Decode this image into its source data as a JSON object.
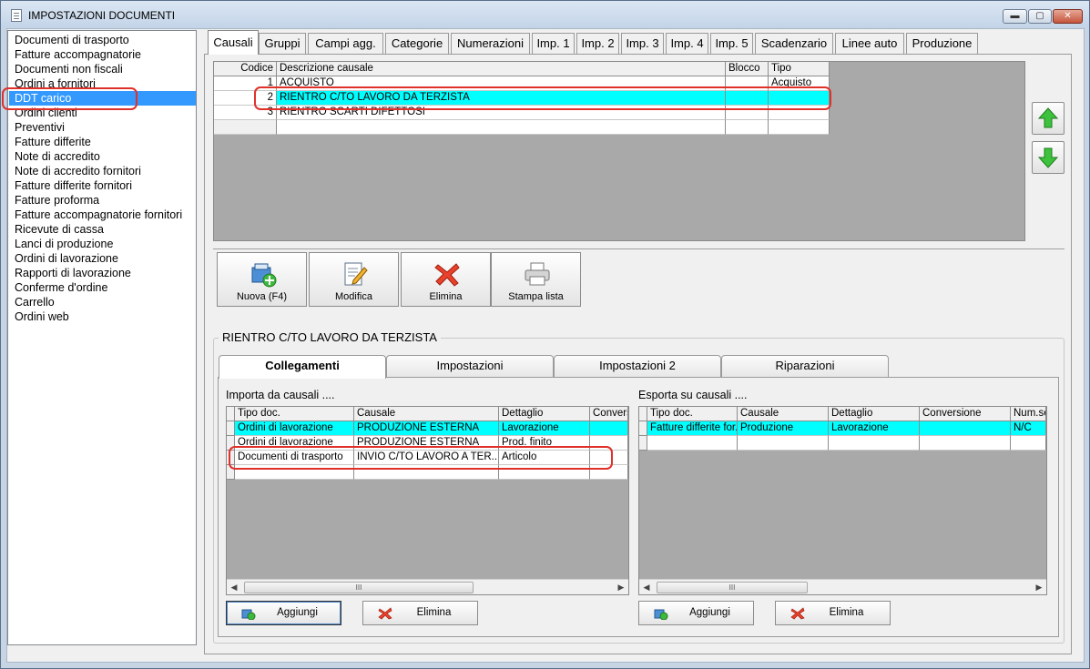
{
  "window": {
    "title": "IMPOSTAZIONI DOCUMENTI",
    "min_label": "▬",
    "max_label": "▢",
    "close_label": "✕"
  },
  "doc_list": [
    "Documenti di trasporto",
    "Fatture accompagnatorie",
    "Documenti non fiscali",
    "Ordini a fornitori",
    "DDT carico",
    "Ordini clienti",
    "Preventivi",
    "Fatture differite",
    "Note di accredito",
    "Note di accredito fornitori",
    "Fatture differite fornitori",
    "Fatture proforma",
    "Fatture accompagnatorie fornitori",
    "Ricevute di cassa",
    "Lanci di produzione",
    "Ordini di lavorazione",
    "Rapporti di lavorazione",
    "Conferme d'ordine",
    "Carrello",
    "Ordini web"
  ],
  "doc_list_selected_index": 4,
  "main_tabs": [
    "Causali",
    "Gruppi",
    "Campi agg.",
    "Categorie",
    "Numerazioni",
    "Imp. 1",
    "Imp. 2",
    "Imp. 3",
    "Imp. 4",
    "Imp. 5",
    "Scadenzario",
    "Linee auto",
    "Produzione"
  ],
  "causali_grid": {
    "headers": {
      "codice": "Codice",
      "descrizione": "Descrizione causale",
      "blocco": "Blocco",
      "tipo": "Tipo"
    },
    "rows": [
      {
        "codice": "1",
        "descrizione": "ACQUISTO",
        "blocco": "",
        "tipo": "Acquisto"
      },
      {
        "codice": "2",
        "descrizione": "RIENTRO C/TO LAVORO DA TERZISTA",
        "blocco": "",
        "tipo": ""
      },
      {
        "codice": "3",
        "descrizione": "RIENTRO SCARTI DIFETTOSI",
        "blocco": "",
        "tipo": ""
      }
    ],
    "selected_row": 1
  },
  "toolbar": {
    "nuova": "Nuova (F4)",
    "modifica": "Modifica",
    "elimina": "Elimina",
    "stampa": "Stampa lista"
  },
  "detail": {
    "title": "RIENTRO C/TO LAVORO DA TERZISTA",
    "tabs": [
      "Collegamenti",
      "Impostazioni",
      "Impostazioni 2",
      "Riparazioni"
    ],
    "importa": {
      "label": "Importa da causali ....",
      "headers": {
        "tipo": "Tipo doc.",
        "causale": "Causale",
        "dettaglio": "Dettaglio",
        "conversione": "Convers"
      },
      "rows": [
        {
          "tipo": "Ordini di lavorazione",
          "causale": "PRODUZIONE ESTERNA",
          "dettaglio": "Lavorazione",
          "conversione": ""
        },
        {
          "tipo": "Ordini di lavorazione",
          "causale": "PRODUZIONE ESTERNA",
          "dettaglio": "Prod. finito",
          "conversione": ""
        },
        {
          "tipo": "Documenti di trasporto",
          "causale": "INVIO C/TO LAVORO A TER...",
          "dettaglio": "Articolo",
          "conversione": ""
        }
      ],
      "aggiungi": "Aggiungi",
      "elimina": "Elimina"
    },
    "esporta": {
      "label": "Esporta su causali ....",
      "headers": {
        "tipo": "Tipo doc.",
        "causale": "Causale",
        "dettaglio": "Dettaglio",
        "conversione": "Conversione",
        "num": "Num.se"
      },
      "rows": [
        {
          "tipo": "Fatture differite for...",
          "causale": "Produzione",
          "dettaglio": "Lavorazione",
          "conversione": "",
          "num": "N/C"
        }
      ],
      "aggiungi": "Aggiungi",
      "elimina": "Elimina"
    },
    "scroll_thumb": "III"
  },
  "colors": {
    "selection": "#3399ff",
    "highlight_row": "#00ffff",
    "annotation": "#e0302a",
    "grid_bg": "#a9a9a9"
  }
}
